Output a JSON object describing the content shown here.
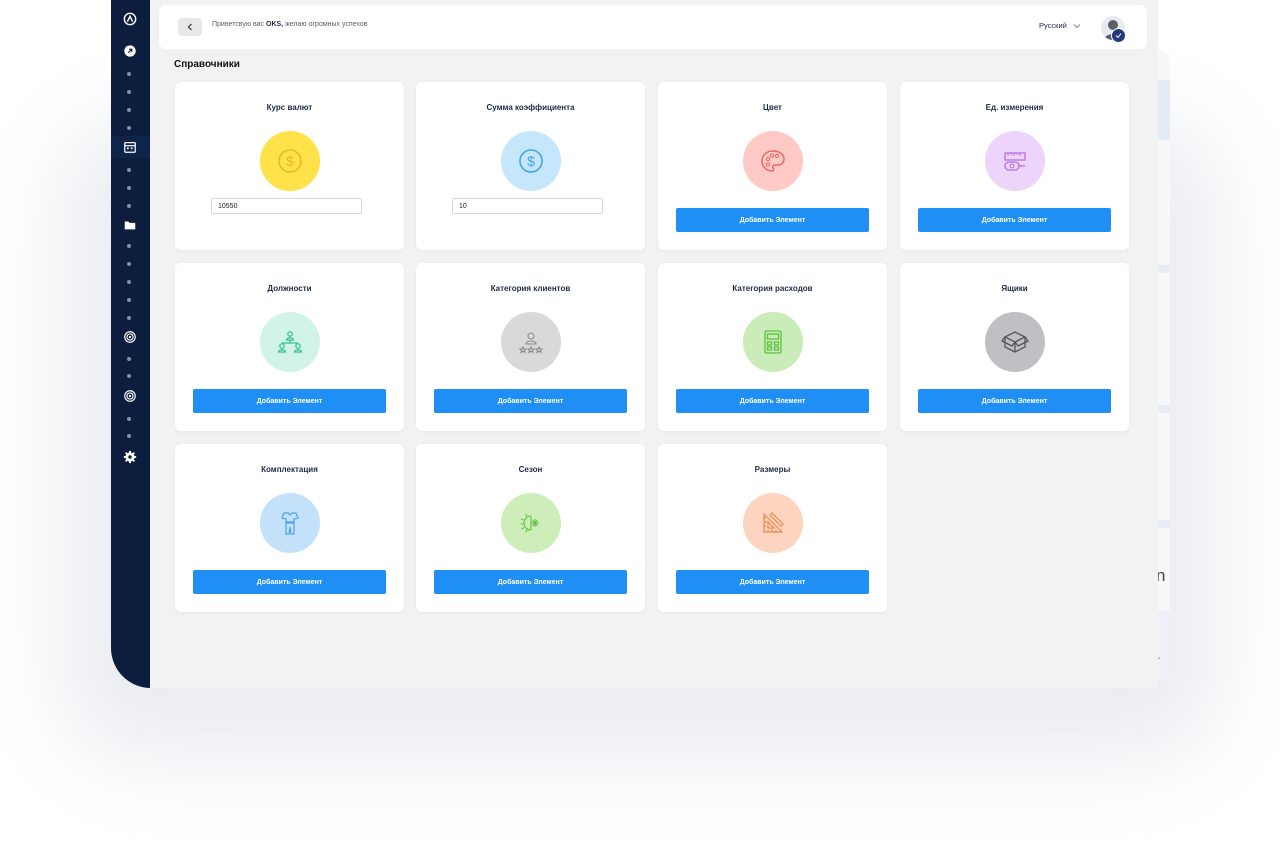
{
  "app": {
    "greeting_prefix": "Приветсвую вас",
    "greeting_user": "OKS,",
    "greeting_suffix": "желаю огромных успехов",
    "language": "Русский",
    "page_title": "Справочники",
    "background_peek_text": "n",
    "background_peek_text_2": "r"
  },
  "colors": {
    "sidebar": "#0c1d3d",
    "button": "#1f8ff5",
    "page_bg": "#f2f2f2"
  },
  "cards": [
    {
      "title": "Курс валют",
      "icon": "dollar-icon",
      "color": "#ffe14a",
      "input_value": "10550"
    },
    {
      "title": "Сумма коэффициента",
      "icon": "dollar-icon",
      "color": "#c6e6fb",
      "input_value": "10"
    },
    {
      "title": "Цвет",
      "icon": "palette-icon",
      "color": "#ffc9c5",
      "button": "Добавить Элемент"
    },
    {
      "title": "Ед. измерения",
      "icon": "measuring-tape-icon",
      "color": "#ecd4fb",
      "button": "Добавить Элемент"
    },
    {
      "title": "Должности",
      "icon": "org-chart-icon",
      "color": "#d2f3e8",
      "button": "Добавить Элемент"
    },
    {
      "title": "Категория клиентов",
      "icon": "client-rating-icon",
      "color": "#d9d9d9",
      "button": "Добавить Элемент"
    },
    {
      "title": "Категория расходов",
      "icon": "calculator-icon",
      "color": "#c9ecb9",
      "button": "Добавить Элемент"
    },
    {
      "title": "Ящики",
      "icon": "box-icon",
      "color": "#bfbfc4",
      "button": "Добавить Элемент"
    },
    {
      "title": "Комплектация",
      "icon": "clothing-icon",
      "color": "#c3e1f9",
      "button": "Добавить Элемент"
    },
    {
      "title": "Сезон",
      "icon": "season-icon",
      "color": "#cdeeb9",
      "button": "Добавить Элемент"
    },
    {
      "title": "Размеры",
      "icon": "ruler-triangle-icon",
      "color": "#fdd4bf",
      "button": "Добавить Элемент"
    }
  ],
  "sidebar": {
    "items": [
      "logo-icon",
      "dashboard-icon",
      "calendar-icon",
      "folder-icon",
      "radio-icon",
      "radio-icon",
      "settings-icon"
    ]
  }
}
